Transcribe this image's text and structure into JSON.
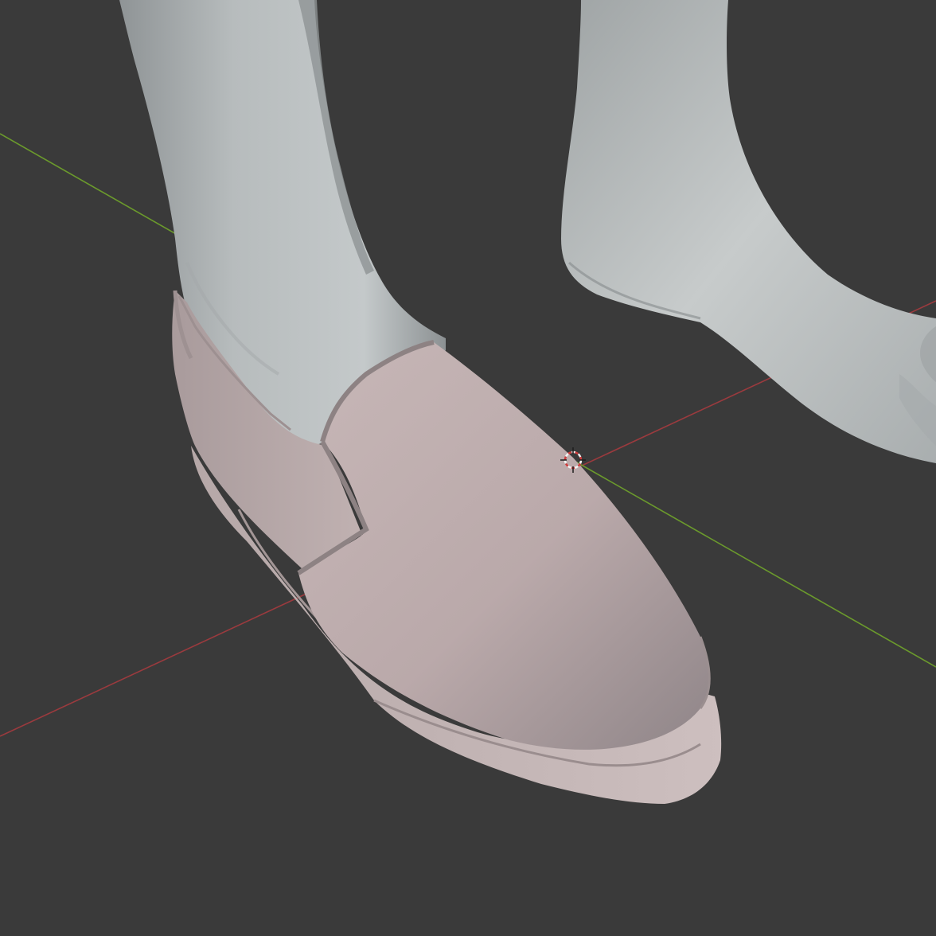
{
  "viewport": {
    "background_color": "#3a3a3a",
    "x_axis_color": "#9b3a3e",
    "y_axis_color": "#6b9a2c",
    "skin_color": "#b7bbbc",
    "shoe_color": "#bcaaa9",
    "cursor_colors": [
      "#cf3b3b",
      "#f2f2f2"
    ],
    "icons": [
      "3d-cursor-icon"
    ]
  }
}
